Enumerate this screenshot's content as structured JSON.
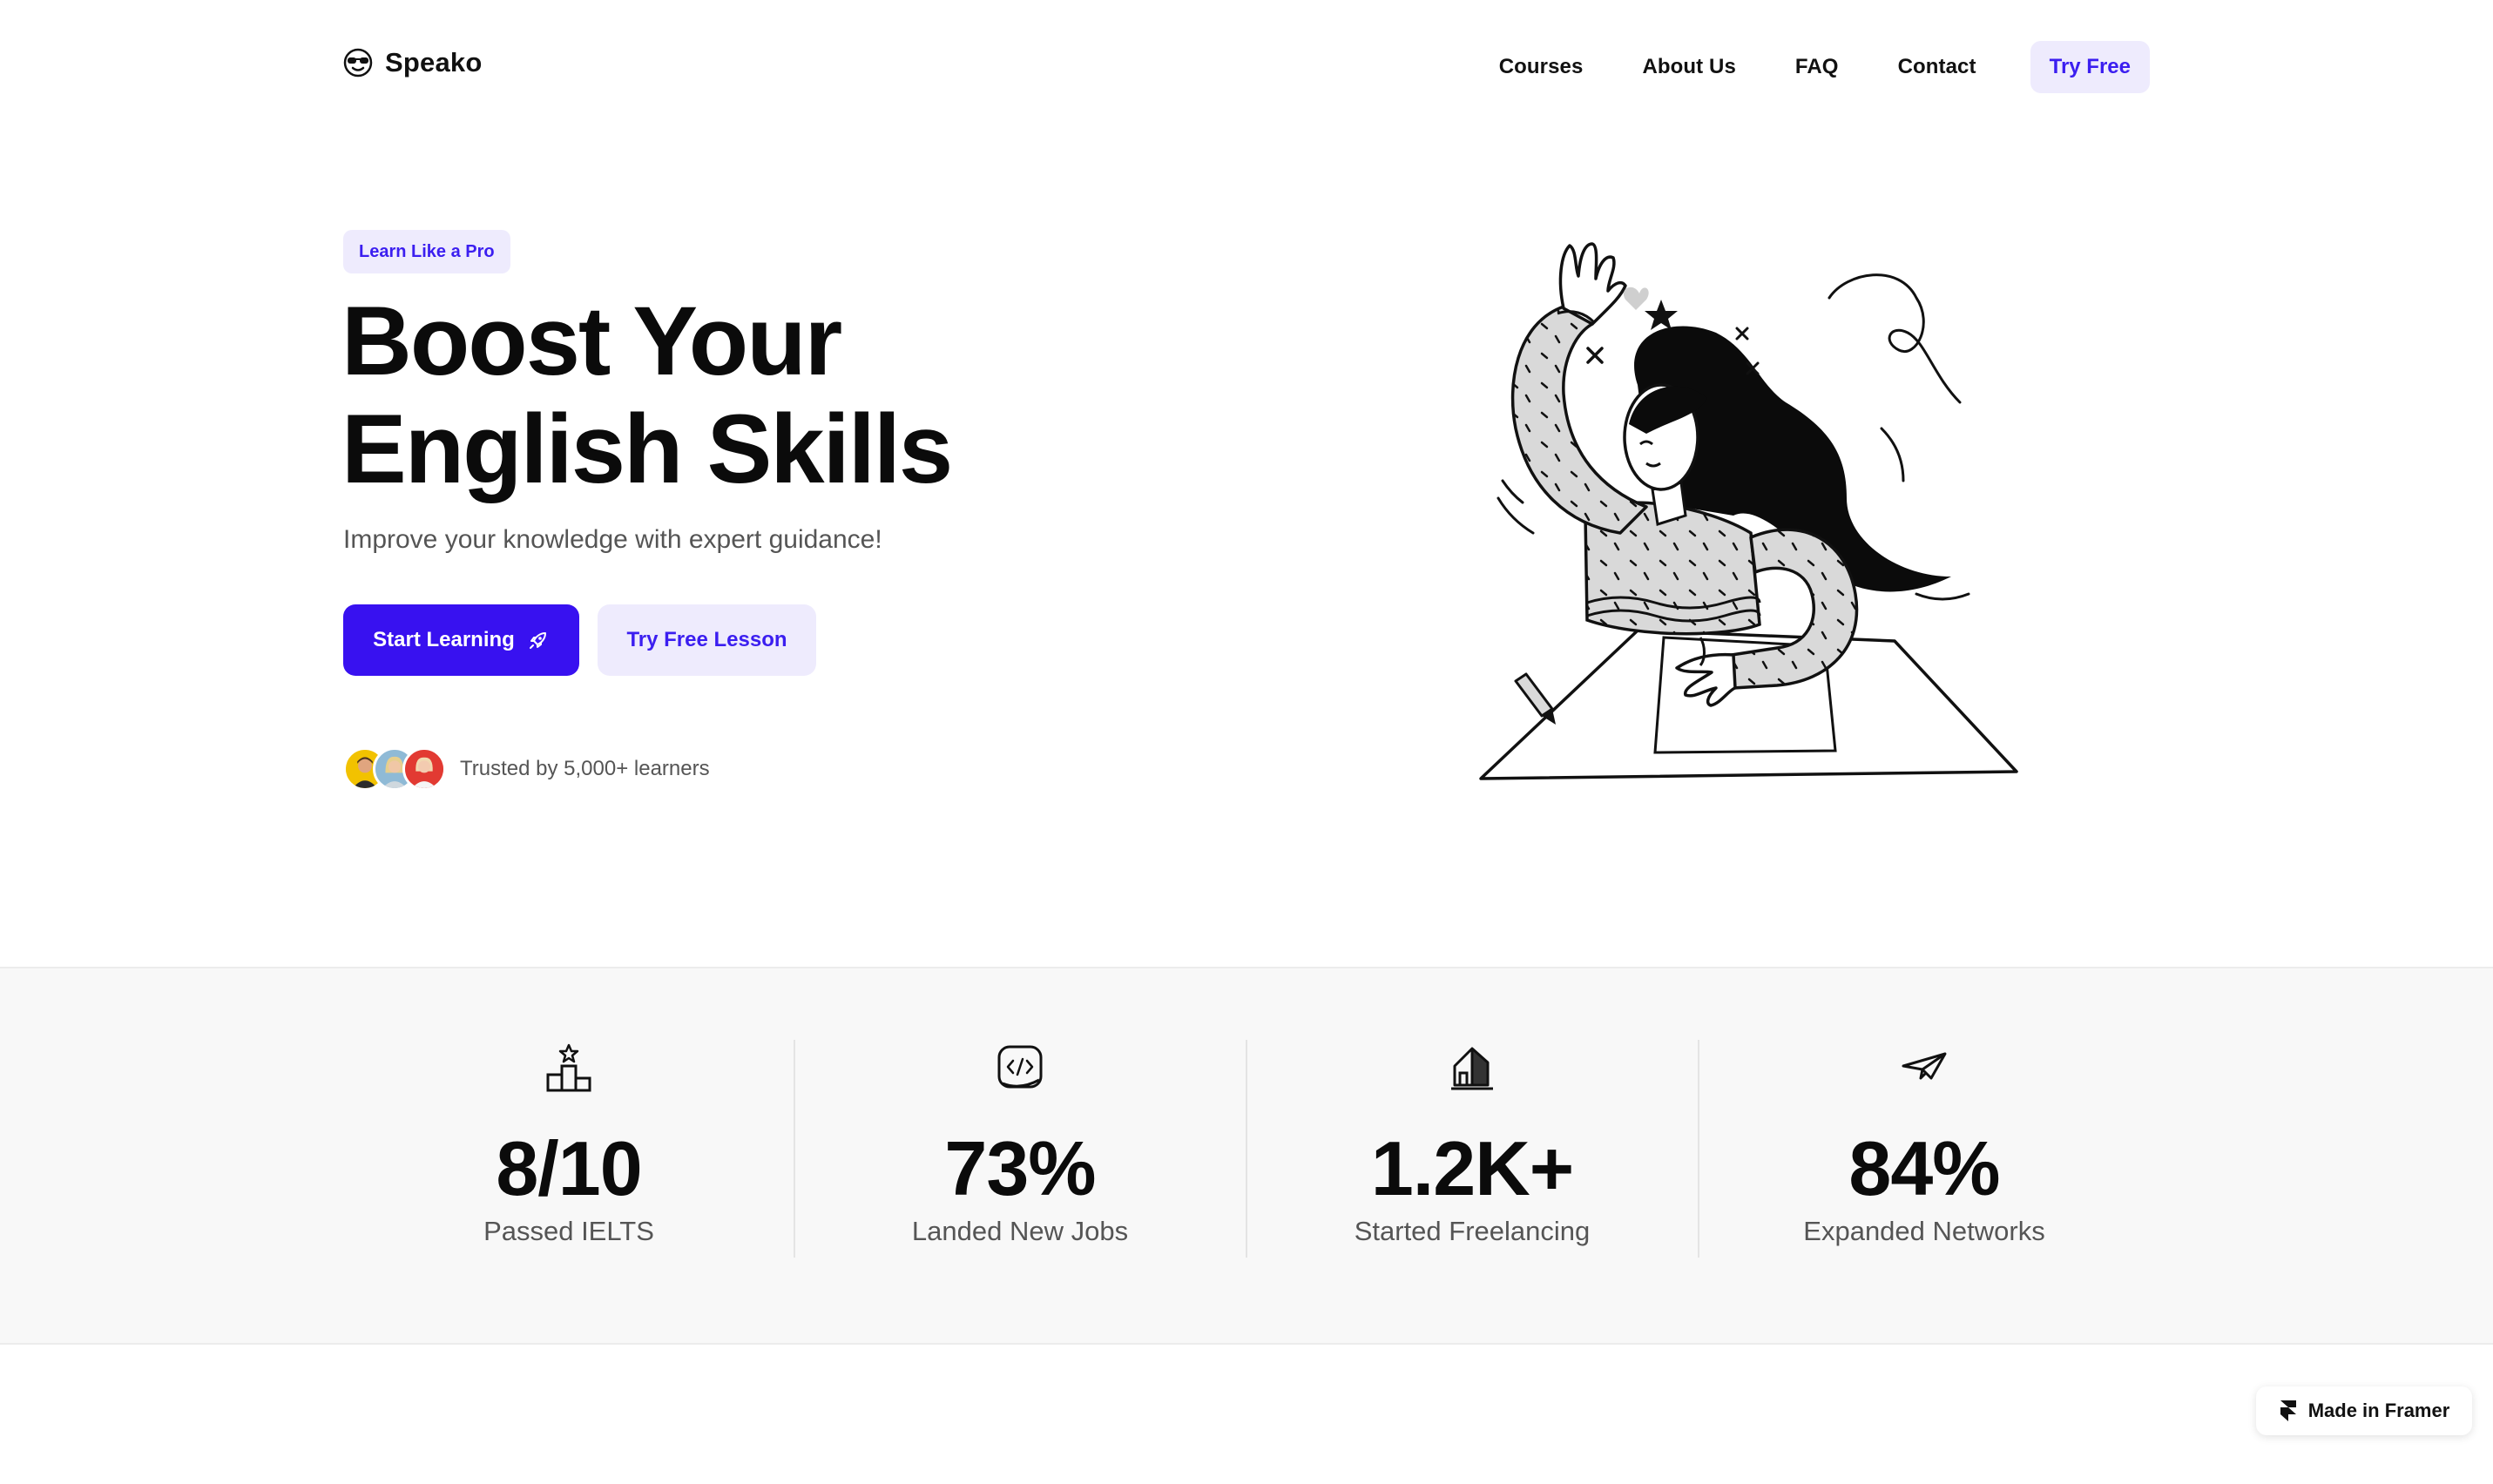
{
  "nav": {
    "brand": "Speako",
    "links": [
      "Courses",
      "About Us",
      "FAQ",
      "Contact"
    ],
    "cta": "Try Free"
  },
  "hero": {
    "badge": "Learn Like a Pro",
    "title_line1": "Boost Your",
    "title_line2": "English Skills",
    "subtitle": "Improve your knowledge with expert guidance!",
    "primary_button": "Start Learning",
    "secondary_button": "Try Free Lesson",
    "trust_text": "Trusted by 5,000+ learners"
  },
  "stats": [
    {
      "icon": "podium-star-icon",
      "value": "8/10",
      "label": "Passed IELTS"
    },
    {
      "icon": "code-icon",
      "value": "73%",
      "label": "Landed New Jobs"
    },
    {
      "icon": "house-icon",
      "value": "1.2K+",
      "label": "Started Freelancing"
    },
    {
      "icon": "paper-plane-icon",
      "value": "84%",
      "label": "Expanded Networks"
    }
  ],
  "footer_badge": "Made in Framer",
  "colors": {
    "accent": "#3811f0",
    "accent_soft": "#eeebfd",
    "stats_bg": "#f8f8f8"
  }
}
